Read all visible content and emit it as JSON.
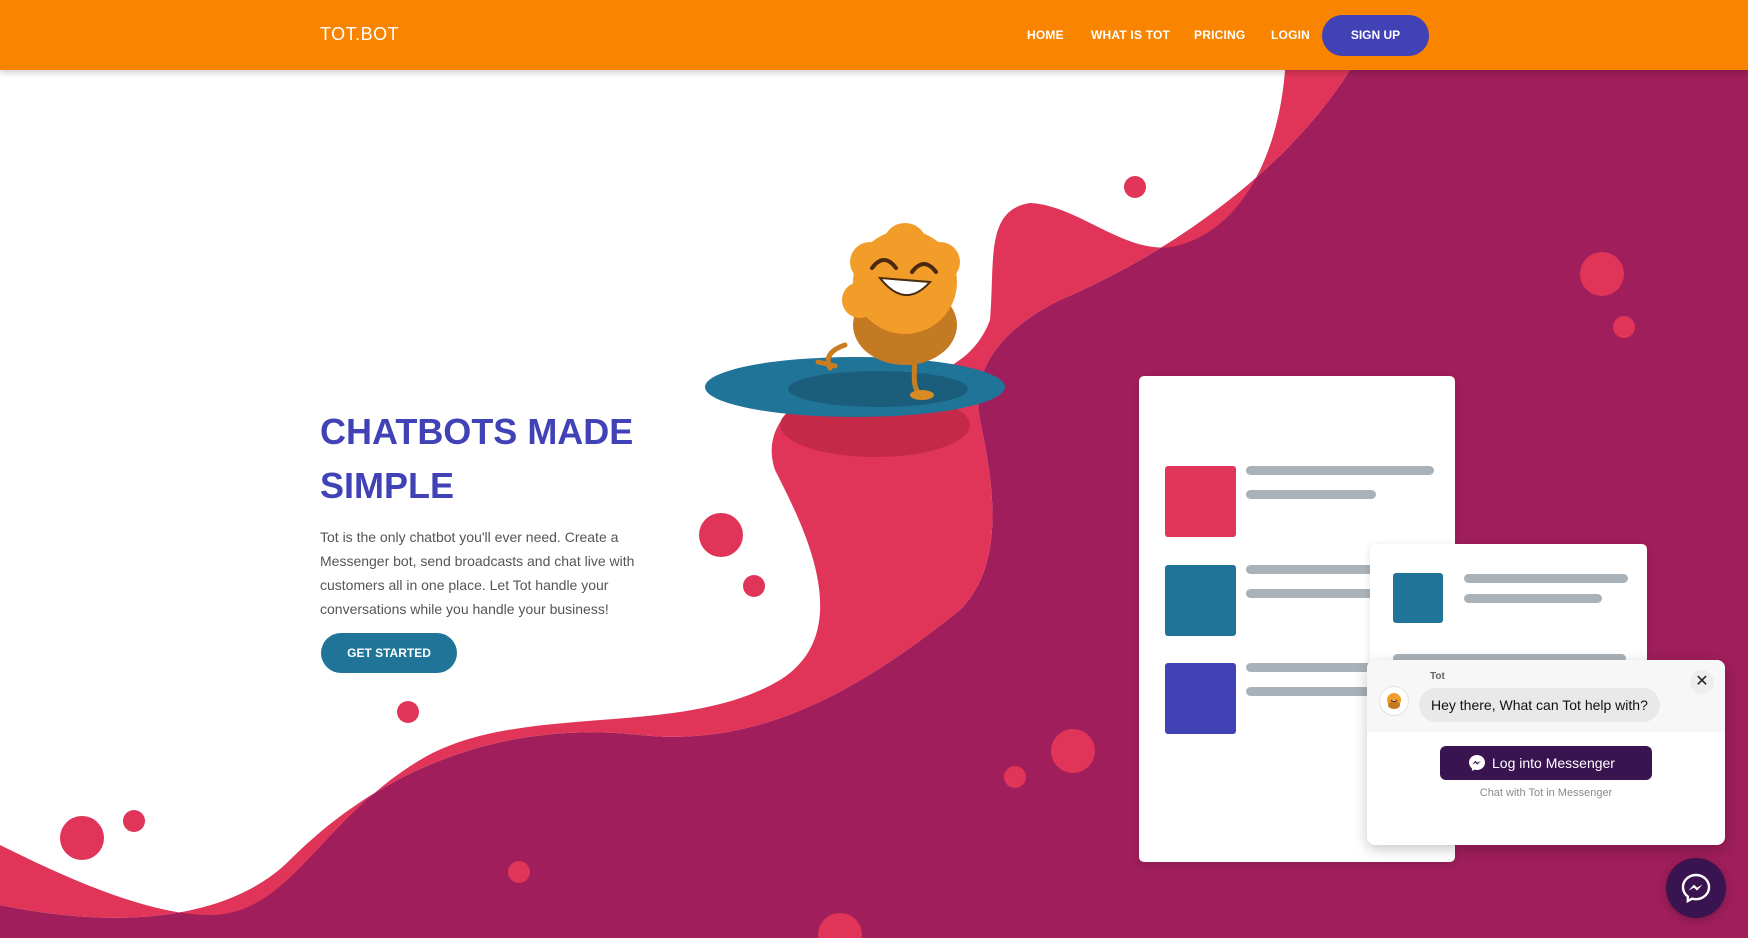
{
  "header": {
    "brand": "TOT.BOT",
    "nav": [
      {
        "label": "HOME"
      },
      {
        "label": "WHAT IS TOT"
      },
      {
        "label": "PRICING"
      },
      {
        "label": "LOGIN"
      }
    ],
    "signup_label": "SIGN UP"
  },
  "hero": {
    "title_line1": "CHATBOTS MADE",
    "title_line2": "SIMPLE",
    "description": "Tot is the only chatbot you'll ever need. Create a Messenger bot, send broadcasts and chat live with customers all in one place. Let Tot handle your conversations while you handle your business!",
    "cta_label": "GET STARTED"
  },
  "chat_widget": {
    "bot_name": "Tot",
    "message": "Hey there, What can Tot help with?",
    "close_icon": "close-icon",
    "login_label": "Log into Messenger",
    "note": "Chat with Tot in Messenger"
  },
  "colors": {
    "header": "#f88400",
    "primary": "#4142b6",
    "teal": "#1f7497",
    "pink": "#e03558",
    "purple": "#9f1e5b",
    "messenger": "#3a1450"
  },
  "icons": {
    "messenger": "messenger-icon",
    "mascot": "tot-mascot-illustration"
  }
}
